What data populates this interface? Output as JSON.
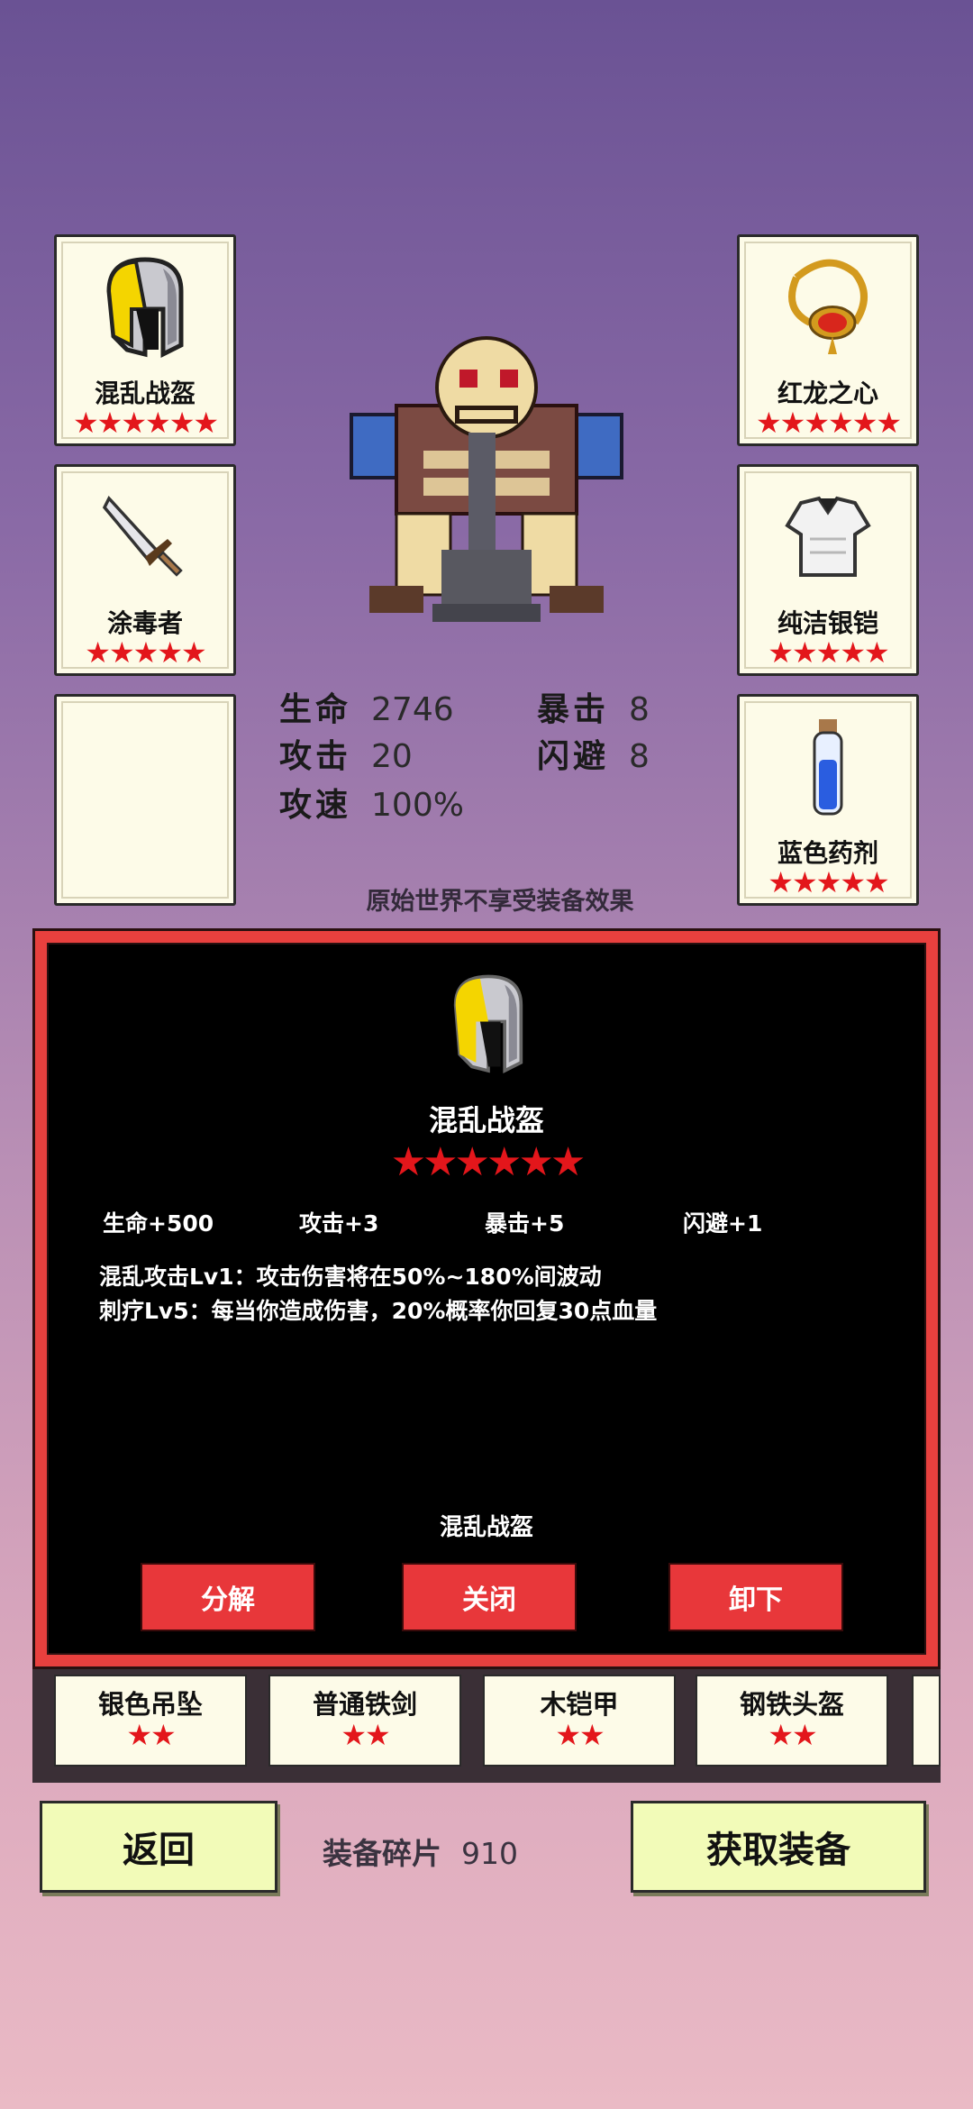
{
  "equipment_slots": {
    "left": [
      {
        "name": "混乱战盔",
        "stars": "★★★★★★",
        "icon": "helmet-icon"
      },
      {
        "name": "涂毒者",
        "stars": "★★★★★",
        "icon": "dagger-icon"
      },
      {
        "name": "",
        "stars": "",
        "icon": "empty-slot"
      }
    ],
    "right": [
      {
        "name": "红龙之心",
        "stars": "★★★★★★",
        "icon": "amulet-icon"
      },
      {
        "name": "纯洁银铠",
        "stars": "★★★★★",
        "icon": "armor-icon"
      },
      {
        "name": "蓝色药剂",
        "stars": "★★★★★",
        "icon": "potion-icon"
      }
    ]
  },
  "stats": {
    "hp_label": "生命",
    "hp_value": "2746",
    "crit_label": "暴击",
    "crit_value": "8",
    "atk_label": "攻击",
    "atk_value": "20",
    "dodge_label": "闪避",
    "dodge_value": "8",
    "speed_label": "攻速",
    "speed_value": "100%"
  },
  "note": "原始世界不享受装备效果",
  "detail": {
    "title": "混乱战盔",
    "stars": "★★★★★★",
    "stats": [
      "生命+500",
      "攻击+3",
      "暴击+5",
      "闪避+1"
    ],
    "desc_line1": "混乱攻击Lv1：攻击伤害将在50%~180%间波动",
    "desc_line2": "刺疗Lv5：每当你造成伤害，20%概率你回复30点血量",
    "footer_name": "混乱战盔",
    "buttons": {
      "decompose": "分解",
      "close": "关闭",
      "unequip": "卸下"
    }
  },
  "inventory": [
    {
      "name": "银色吊坠",
      "stars": "★★"
    },
    {
      "name": "普通铁剑",
      "stars": "★★"
    },
    {
      "name": "木铠甲",
      "stars": "★★"
    },
    {
      "name": "钢铁头盔",
      "stars": "★★"
    }
  ],
  "bottom": {
    "back_label": "返回",
    "fragments_label": "装备碎片",
    "fragments_value": "910",
    "get_label": "获取装备"
  },
  "colors": {
    "star_red": "#e3161b",
    "panel_border": "#e8403e",
    "button_red": "#e8373a",
    "bottom_button": "#f2fbb8"
  }
}
